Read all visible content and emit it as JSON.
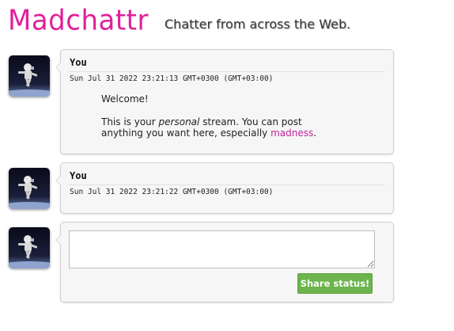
{
  "header": {
    "logo": "Madchattr",
    "tagline": "Chatter from across the Web."
  },
  "posts": [
    {
      "author": "You",
      "timestamp": "Sun Jul 31 2022 23:21:13 GMT+0300 (GMT+03:00)",
      "body": {
        "line1": "Welcome!",
        "line2_pre": "This is your ",
        "line2_em": "personal",
        "line2_post": " stream. You can post",
        "line3_pre": "anything you want here, especially ",
        "line3_link": "madness",
        "line3_post": "."
      }
    },
    {
      "author": "You",
      "timestamp": "Sun Jul 31 2022 23:21:22 GMT+0300 (GMT+03:00)"
    }
  ],
  "compose": {
    "value": "",
    "button_label": "Share status!"
  },
  "colors": {
    "logo": "#e0209a",
    "link": "#c0249a",
    "button": "#6cb44c"
  },
  "icons": {
    "avatar": "astronaut-avatar-icon"
  }
}
